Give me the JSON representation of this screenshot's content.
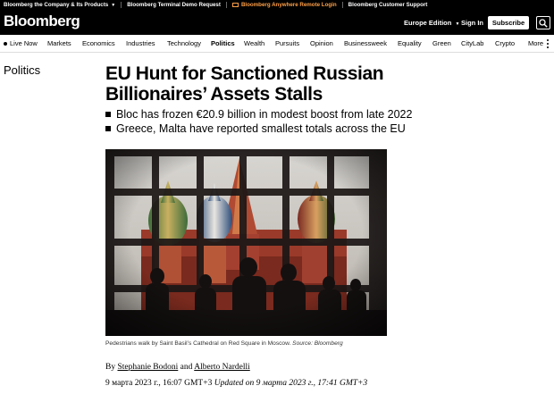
{
  "utility_bar": {
    "items": [
      {
        "label": "Bloomberg the Company & Its Products",
        "has_caret": true
      },
      {
        "label": "Bloomberg Terminal Demo Request",
        "has_icon": true
      },
      {
        "label": "Bloomberg Anywhere Remote Login",
        "has_icon": true,
        "accent": "#ff9f45"
      },
      {
        "label": "Bloomberg Customer Support"
      }
    ]
  },
  "header": {
    "logo": "Bloomberg",
    "edition": "Europe Edition",
    "signin": "Sign In",
    "subscribe": "Subscribe",
    "search_icon": "search-icon"
  },
  "nav": {
    "items": [
      {
        "label": "Live Now"
      },
      {
        "label": "Markets"
      },
      {
        "label": "Economics"
      },
      {
        "label": "Industries"
      },
      {
        "label": "Technology"
      },
      {
        "label": "Politics",
        "active": true
      },
      {
        "label": "Wealth"
      },
      {
        "label": "Pursuits"
      },
      {
        "label": "Opinion"
      },
      {
        "label": "Businessweek"
      },
      {
        "label": "Equality"
      },
      {
        "label": "Green"
      },
      {
        "label": "CityLab"
      },
      {
        "label": "Crypto"
      },
      {
        "label": "More"
      }
    ]
  },
  "article": {
    "section": "Politics",
    "headline": "EU Hunt for Sanctioned Russian Billionaires’ Assets Stalls",
    "bullets": [
      "Bloc has frozen €20.9 billion in modest boost from late 2022",
      "Greece, Malta have reported smallest totals across the EU"
    ],
    "caption": "Pedestrians walk by Saint Basil’s Cathedral on Red Square in Moscow.",
    "caption_source": "Source: Bloomberg",
    "byline_prefix": "By",
    "author1": "Stephanie Bodoni",
    "byline_and": "and",
    "author2": "Alberto Nardelli",
    "published": "9 марта 2023 г., 16:07 GMT+3",
    "updated": "Updated on 9 марта 2023 г., 17:41 GMT+3"
  }
}
